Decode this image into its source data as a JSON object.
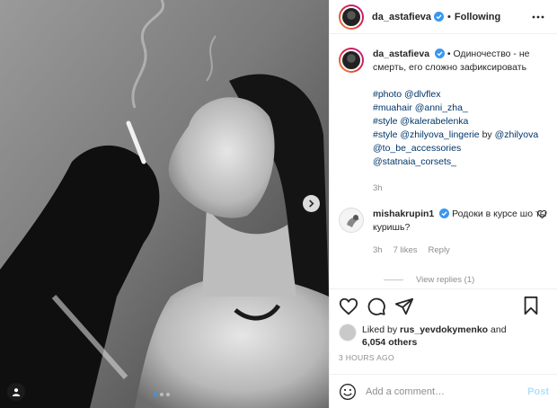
{
  "post": {
    "username": "da_astafieva",
    "separator": "•",
    "follow_state": "Following",
    "caption_text": "Одиночество - не смерть, его сложно зафиксировать",
    "credits": [
      {
        "label": "#photo",
        "handle": "@dlvflex"
      },
      {
        "label": "#muahair",
        "handle": "@anni_zha_"
      },
      {
        "label": "#style",
        "handle": "@kalerabelenka"
      },
      {
        "label": "#style",
        "handle": "@zhilyova_lingerie",
        "joiner": "by",
        "handle2": "@zhilyova"
      }
    ],
    "extra_handles": [
      "@to_be_accessories",
      "@statnaia_corsets_"
    ],
    "caption_age": "3h"
  },
  "comment": {
    "username": "mishakrupin1",
    "text": "Родоки в курсе шо ты куришь?",
    "age": "3h",
    "likes": "7 likes",
    "reply_label": "Reply",
    "view_replies": "View replies (1)"
  },
  "likes": {
    "prefix": "Liked by",
    "user": "rus_yevdokymenko",
    "joiner": "and",
    "count": "6,054 others"
  },
  "timestamp": "3 HOURS AGO",
  "composer": {
    "placeholder": "Add a comment…",
    "post_label": "Post"
  },
  "icons": {
    "more": "ellipsis-icon",
    "next": "chevron-right-icon",
    "tag": "user-tag-icon",
    "like": "heart-icon",
    "comment": "comment-icon",
    "share": "paper-plane-icon",
    "save": "bookmark-icon",
    "emoji": "smiley-icon",
    "verified": "verified-badge-icon"
  },
  "colors": {
    "link": "#003569",
    "verified": "#3897f0",
    "muted": "#8e8e8e",
    "post_disabled": "#b2dffc"
  }
}
